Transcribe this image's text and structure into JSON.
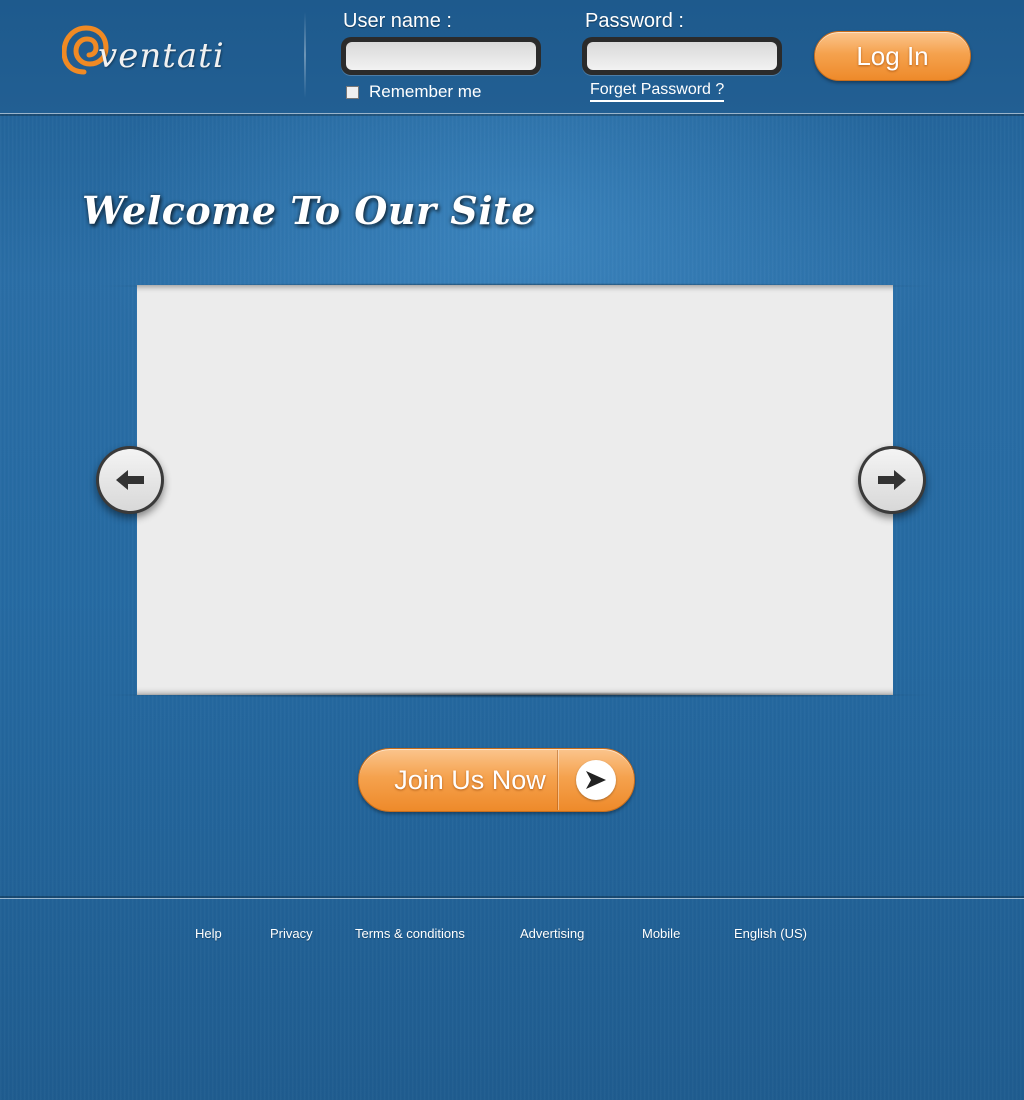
{
  "header": {
    "logo_text": "ventati",
    "username_label": "User name :",
    "username_value": "",
    "password_label": "Password :",
    "password_value": "",
    "remember_label": "Remember me",
    "forgot_label": "Forget Password ?",
    "login_label": "Log In"
  },
  "main": {
    "welcome_title": "Welcome To Our Site",
    "join_label": "Join Us Now"
  },
  "footer": {
    "links": [
      "Help",
      "Privacy",
      "Terms & conditions",
      "Advertising",
      "Mobile",
      "English (US)"
    ]
  },
  "icons": {
    "logo": "spiral-logo-icon",
    "prev": "arrow-left-icon",
    "next": "arrow-right-icon",
    "join": "arrow-right-triangle-icon"
  },
  "colors": {
    "background": "#256aa2",
    "accent_orange": "#f5a24e",
    "slide_panel": "#ececec",
    "logo_orange": "#f08a24"
  }
}
